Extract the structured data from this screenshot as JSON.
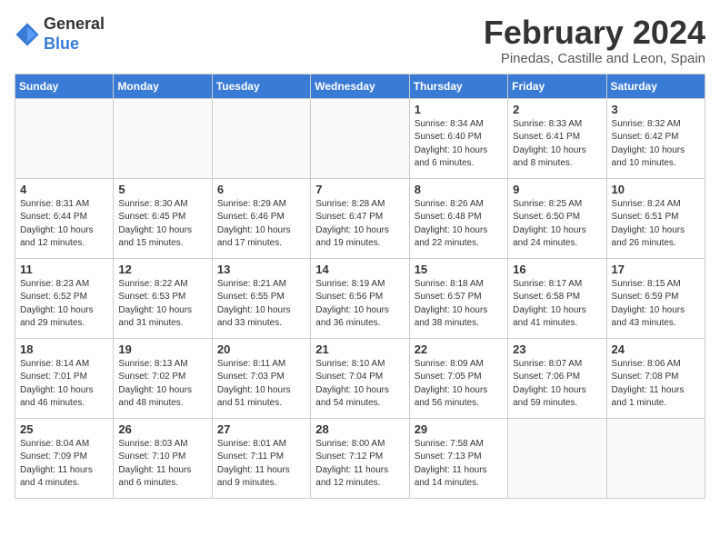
{
  "logo": {
    "general": "General",
    "blue": "Blue"
  },
  "title": "February 2024",
  "subtitle": "Pinedas, Castille and Leon, Spain",
  "days_header": [
    "Sunday",
    "Monday",
    "Tuesday",
    "Wednesday",
    "Thursday",
    "Friday",
    "Saturday"
  ],
  "weeks": [
    [
      {
        "day": "",
        "info": ""
      },
      {
        "day": "",
        "info": ""
      },
      {
        "day": "",
        "info": ""
      },
      {
        "day": "",
        "info": ""
      },
      {
        "day": "1",
        "info": "Sunrise: 8:34 AM\nSunset: 6:40 PM\nDaylight: 10 hours\nand 6 minutes."
      },
      {
        "day": "2",
        "info": "Sunrise: 8:33 AM\nSunset: 6:41 PM\nDaylight: 10 hours\nand 8 minutes."
      },
      {
        "day": "3",
        "info": "Sunrise: 8:32 AM\nSunset: 6:42 PM\nDaylight: 10 hours\nand 10 minutes."
      }
    ],
    [
      {
        "day": "4",
        "info": "Sunrise: 8:31 AM\nSunset: 6:44 PM\nDaylight: 10 hours\nand 12 minutes."
      },
      {
        "day": "5",
        "info": "Sunrise: 8:30 AM\nSunset: 6:45 PM\nDaylight: 10 hours\nand 15 minutes."
      },
      {
        "day": "6",
        "info": "Sunrise: 8:29 AM\nSunset: 6:46 PM\nDaylight: 10 hours\nand 17 minutes."
      },
      {
        "day": "7",
        "info": "Sunrise: 8:28 AM\nSunset: 6:47 PM\nDaylight: 10 hours\nand 19 minutes."
      },
      {
        "day": "8",
        "info": "Sunrise: 8:26 AM\nSunset: 6:48 PM\nDaylight: 10 hours\nand 22 minutes."
      },
      {
        "day": "9",
        "info": "Sunrise: 8:25 AM\nSunset: 6:50 PM\nDaylight: 10 hours\nand 24 minutes."
      },
      {
        "day": "10",
        "info": "Sunrise: 8:24 AM\nSunset: 6:51 PM\nDaylight: 10 hours\nand 26 minutes."
      }
    ],
    [
      {
        "day": "11",
        "info": "Sunrise: 8:23 AM\nSunset: 6:52 PM\nDaylight: 10 hours\nand 29 minutes."
      },
      {
        "day": "12",
        "info": "Sunrise: 8:22 AM\nSunset: 6:53 PM\nDaylight: 10 hours\nand 31 minutes."
      },
      {
        "day": "13",
        "info": "Sunrise: 8:21 AM\nSunset: 6:55 PM\nDaylight: 10 hours\nand 33 minutes."
      },
      {
        "day": "14",
        "info": "Sunrise: 8:19 AM\nSunset: 6:56 PM\nDaylight: 10 hours\nand 36 minutes."
      },
      {
        "day": "15",
        "info": "Sunrise: 8:18 AM\nSunset: 6:57 PM\nDaylight: 10 hours\nand 38 minutes."
      },
      {
        "day": "16",
        "info": "Sunrise: 8:17 AM\nSunset: 6:58 PM\nDaylight: 10 hours\nand 41 minutes."
      },
      {
        "day": "17",
        "info": "Sunrise: 8:15 AM\nSunset: 6:59 PM\nDaylight: 10 hours\nand 43 minutes."
      }
    ],
    [
      {
        "day": "18",
        "info": "Sunrise: 8:14 AM\nSunset: 7:01 PM\nDaylight: 10 hours\nand 46 minutes."
      },
      {
        "day": "19",
        "info": "Sunrise: 8:13 AM\nSunset: 7:02 PM\nDaylight: 10 hours\nand 48 minutes."
      },
      {
        "day": "20",
        "info": "Sunrise: 8:11 AM\nSunset: 7:03 PM\nDaylight: 10 hours\nand 51 minutes."
      },
      {
        "day": "21",
        "info": "Sunrise: 8:10 AM\nSunset: 7:04 PM\nDaylight: 10 hours\nand 54 minutes."
      },
      {
        "day": "22",
        "info": "Sunrise: 8:09 AM\nSunset: 7:05 PM\nDaylight: 10 hours\nand 56 minutes."
      },
      {
        "day": "23",
        "info": "Sunrise: 8:07 AM\nSunset: 7:06 PM\nDaylight: 10 hours\nand 59 minutes."
      },
      {
        "day": "24",
        "info": "Sunrise: 8:06 AM\nSunset: 7:08 PM\nDaylight: 11 hours\nand 1 minute."
      }
    ],
    [
      {
        "day": "25",
        "info": "Sunrise: 8:04 AM\nSunset: 7:09 PM\nDaylight: 11 hours\nand 4 minutes."
      },
      {
        "day": "26",
        "info": "Sunrise: 8:03 AM\nSunset: 7:10 PM\nDaylight: 11 hours\nand 6 minutes."
      },
      {
        "day": "27",
        "info": "Sunrise: 8:01 AM\nSunset: 7:11 PM\nDaylight: 11 hours\nand 9 minutes."
      },
      {
        "day": "28",
        "info": "Sunrise: 8:00 AM\nSunset: 7:12 PM\nDaylight: 11 hours\nand 12 minutes."
      },
      {
        "day": "29",
        "info": "Sunrise: 7:58 AM\nSunset: 7:13 PM\nDaylight: 11 hours\nand 14 minutes."
      },
      {
        "day": "",
        "info": ""
      },
      {
        "day": "",
        "info": ""
      }
    ]
  ]
}
